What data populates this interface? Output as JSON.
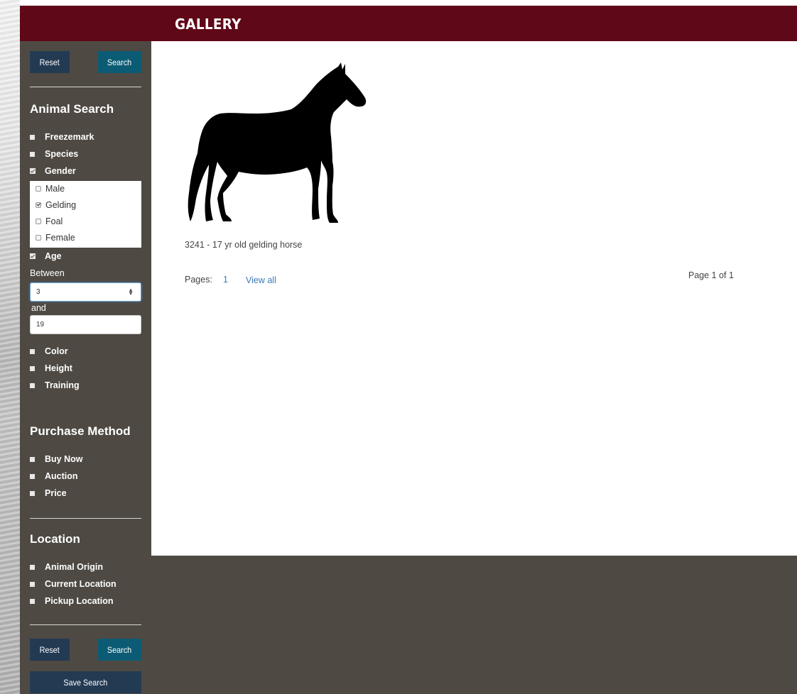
{
  "header": {
    "title": "GALLERY"
  },
  "sidebar": {
    "top_buttons": {
      "reset": "Reset",
      "search": "Search"
    },
    "animal_search": {
      "title": "Animal Search",
      "items": [
        {
          "label": "Freezemark",
          "checked": false
        },
        {
          "label": "Species",
          "checked": false
        },
        {
          "label": "Gender",
          "checked": true
        },
        {
          "label": "Age",
          "checked": true
        },
        {
          "label": "Color",
          "checked": false
        },
        {
          "label": "Height",
          "checked": false
        },
        {
          "label": "Training",
          "checked": false
        }
      ],
      "gender_options": [
        {
          "label": "Male",
          "checked": false
        },
        {
          "label": "Gelding",
          "checked": true
        },
        {
          "label": "Foal",
          "checked": false
        },
        {
          "label": "Female",
          "checked": false
        }
      ],
      "age": {
        "between_label": "Between",
        "and_label": "and",
        "min_value": "3",
        "max_value": "19"
      }
    },
    "purchase_method": {
      "title": "Purchase Method",
      "items": [
        {
          "label": "Buy Now",
          "checked": false
        },
        {
          "label": "Auction",
          "checked": false
        },
        {
          "label": "Price",
          "checked": false
        }
      ]
    },
    "location": {
      "title": "Location",
      "items": [
        {
          "label": "Animal Origin",
          "checked": false
        },
        {
          "label": "Current Location",
          "checked": false
        },
        {
          "label": "Pickup Location",
          "checked": false
        }
      ]
    },
    "bottom_buttons": {
      "reset": "Reset",
      "search": "Search",
      "save": "Save Search"
    }
  },
  "gallery": {
    "items": [
      {
        "caption": "3241 - 17 yr old gelding horse",
        "icon": "horse-silhouette"
      }
    ],
    "pagination": {
      "pages_label": "Pages:",
      "page": "1",
      "view_all": "View all",
      "page_of": "Page 1 of 1"
    }
  },
  "colors": {
    "header": "#5f0818",
    "sidebar": "#4e4a43",
    "reset_button": "#233a53",
    "search_button": "#0c5b74",
    "link": "#3a7ab8"
  }
}
